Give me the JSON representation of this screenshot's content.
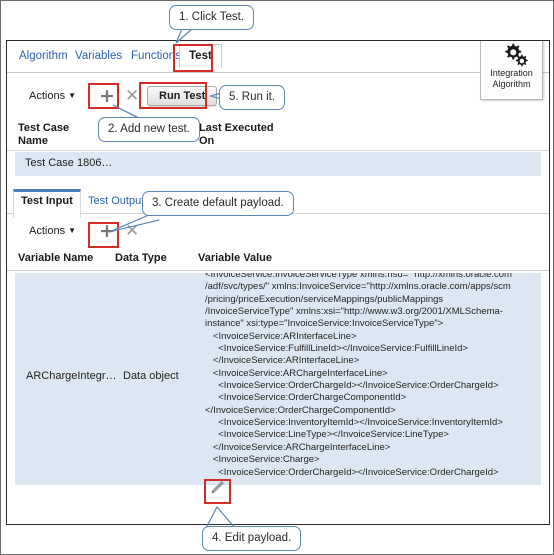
{
  "window": {
    "tabs": [
      {
        "label": "Algorithm",
        "active": false
      },
      {
        "label": "Variables",
        "active": false
      },
      {
        "label": "Functions",
        "active": false
      },
      {
        "label": "Test",
        "active": true
      }
    ],
    "badge": {
      "icon": "gears-icon",
      "line1": "Integration",
      "line2": "Algorithm"
    }
  },
  "test_toolbar": {
    "actions_label": "Actions",
    "caret": "▼",
    "add_icon": "plus-icon",
    "delete_icon": "cross-icon",
    "run_test_label": "Run Test"
  },
  "test_case_table": {
    "columns": [
      {
        "label": "Test Case\nName"
      },
      {
        "label": "Last Executed\nOn"
      }
    ],
    "col0_line1": "Test Case",
    "col0_line2": "Name",
    "col1_line1": "Last Executed",
    "col1_line2": "On",
    "rows": [
      {
        "name": "Test Case 1806…",
        "last_executed_on": ""
      }
    ]
  },
  "sub_tabs": [
    {
      "label": "Test Input",
      "active": true
    },
    {
      "label": "Test Output",
      "active": false
    }
  ],
  "input_toolbar": {
    "actions_label": "Actions",
    "caret": "▼",
    "add_icon": "plus-icon",
    "delete_icon": "cross-icon"
  },
  "variables_grid": {
    "columns": [
      "Variable Name",
      "Data Type",
      "Variable Value"
    ],
    "row": {
      "variable_name": "ARChargeIntegr…",
      "data_type": "Data object",
      "variable_value": "<InvoiceService:InvoiceServiceType xmlns:nsu= \"http://xmlns.oracle.com\n/adf/svc/types/\" xmlns:InvoiceService=\"http://xmlns.oracle.com/apps/scm\n/pricing/priceExecution/serviceMappings/publicMappings\n/InvoiceServiceType\" xmlns:xsi=\"http://www.w3.org/2001/XMLSchema-\ninstance\" xsi:type=\"InvoiceService:InvoiceServiceType\">\n   <InvoiceService:ARInterfaceLine>\n     <InvoiceService:FulfillLineId></InvoiceService:FulfillLineId>\n   </InvoiceService:ARInterfaceLine>\n   <InvoiceService:ARChargeInterfaceLine>\n     <InvoiceService:OrderChargeId></InvoiceService:OrderChargeId>\n     <InvoiceService:OrderChargeComponentId>\n</InvoiceService:OrderChargeComponentId>\n     <InvoiceService:InventoryItemId></InvoiceService:InventoryItemId>\n     <InvoiceService:LineType></InvoiceService:LineType>\n   </InvoiceService:ARChargeInterfaceLine>\n   <InvoiceService:Charge>\n     <InvoiceService:OrderChargeId></InvoiceService:OrderChargeId>"
    },
    "edit_icon": "pencil-icon"
  },
  "callouts": [
    {
      "id": "c1",
      "text": "1. Click Test."
    },
    {
      "id": "c2",
      "text": "2. Add new test."
    },
    {
      "id": "c3",
      "text": "3. Create default payload."
    },
    {
      "id": "c4",
      "text": "4. Edit payload."
    },
    {
      "id": "c5",
      "text": "5. Run it."
    }
  ],
  "colors": {
    "link": "#2a62b5",
    "highlight_red": "#d02e26",
    "row_blue": "#dce7f3",
    "callout_border": "#5b86b8"
  }
}
